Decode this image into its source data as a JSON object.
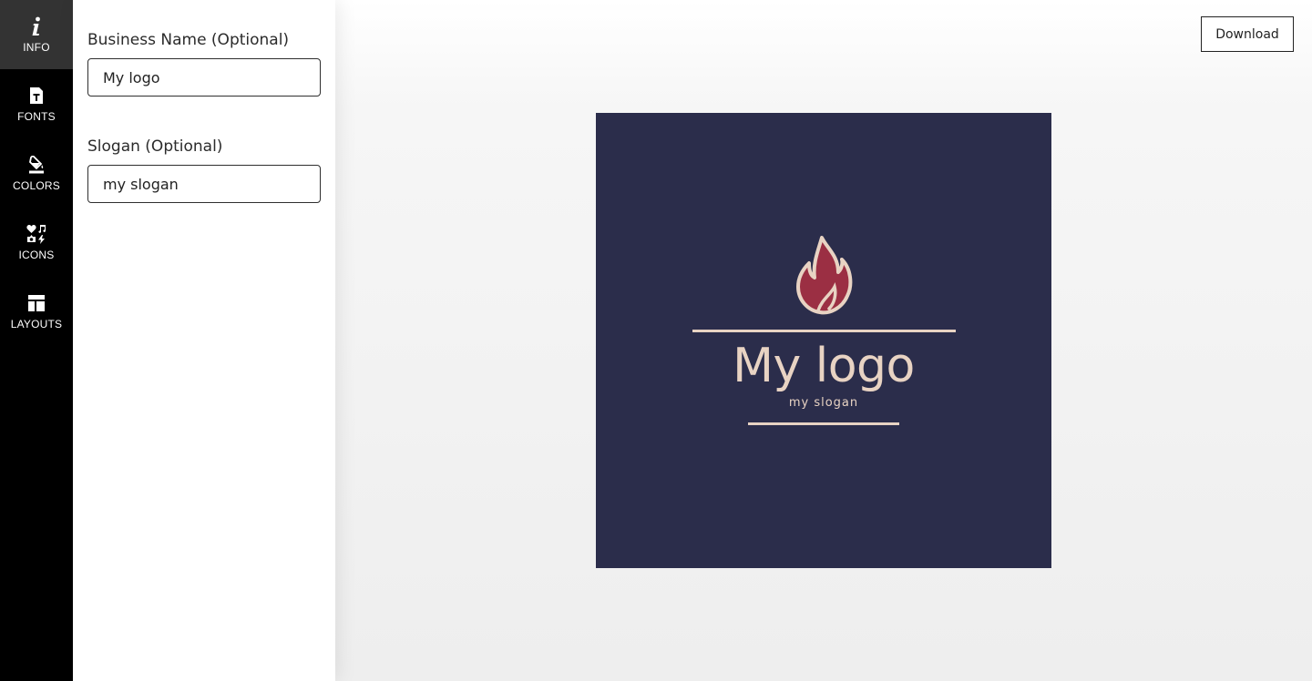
{
  "nav": {
    "items": [
      {
        "label": "INFO",
        "icon": "info-icon",
        "active": true
      },
      {
        "label": "FONTS",
        "icon": "font-file-icon"
      },
      {
        "label": "COLORS",
        "icon": "paint-bucket-icon"
      },
      {
        "label": "ICONS",
        "icon": "icons-grid-icon"
      },
      {
        "label": "LAYOUTS",
        "icon": "layout-icon"
      }
    ]
  },
  "form": {
    "business_name": {
      "label": "Business Name (Optional)",
      "value": "My logo"
    },
    "slogan": {
      "label": "Slogan (Optional)",
      "value": "my slogan"
    }
  },
  "toolbar": {
    "download_label": "Download"
  },
  "logo": {
    "name": "My logo",
    "slogan": "my slogan",
    "icon": "flame-icon",
    "colors": {
      "background": "#2b2d4b",
      "text": "#e8d3c3",
      "icon_fill": "#9b2f43",
      "icon_outline": "#e8d3c3"
    }
  }
}
